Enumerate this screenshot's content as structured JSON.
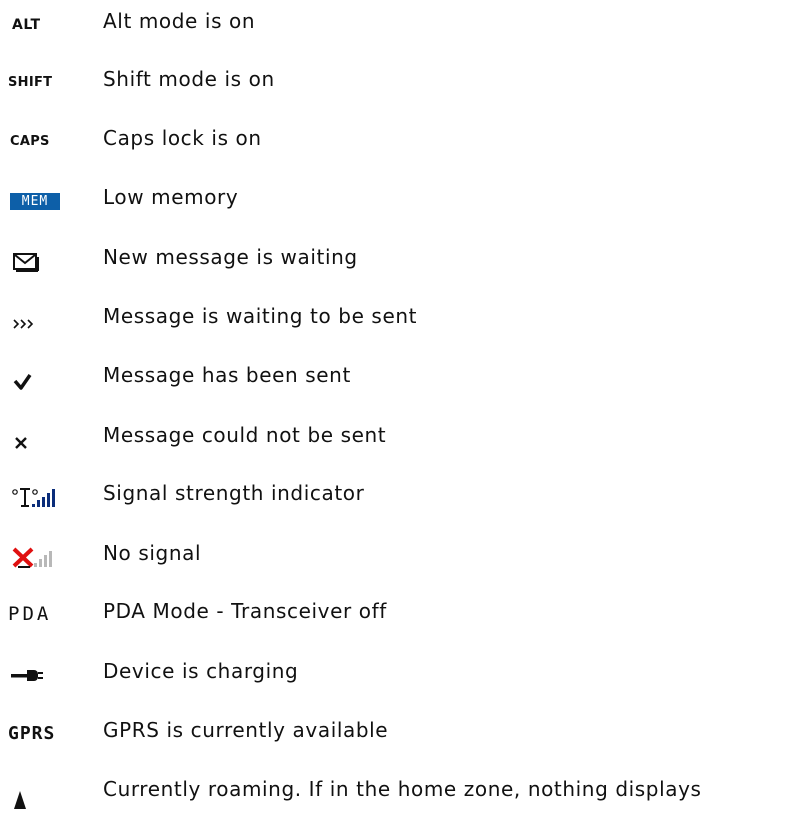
{
  "legend": {
    "items": [
      {
        "icon_name": "alt-icon",
        "icon_text": "ALT",
        "label": "Alt mode is on"
      },
      {
        "icon_name": "shift-icon",
        "icon_text": "SHIFT",
        "label": "Shift mode is on"
      },
      {
        "icon_name": "caps-icon",
        "icon_text": "CAPS",
        "label": "Caps lock is on"
      },
      {
        "icon_name": "mem-icon",
        "icon_text": "MEM",
        "label": "Low memory"
      },
      {
        "icon_name": "envelope-icon",
        "label": "New message is waiting"
      },
      {
        "icon_name": "sending-arrows-icon",
        "label": "Message is waiting to be sent"
      },
      {
        "icon_name": "checkmark-icon",
        "label": "Message has been sent"
      },
      {
        "icon_name": "x-mark-icon",
        "label": "Message could not be sent"
      },
      {
        "icon_name": "signal-strength-icon",
        "label": "Signal strength indicator"
      },
      {
        "icon_name": "no-signal-icon",
        "label": "No signal"
      },
      {
        "icon_name": "pda-icon",
        "icon_text": "PDA",
        "label": "PDA Mode - Transceiver off"
      },
      {
        "icon_name": "charging-plug-icon",
        "label": "Device is charging"
      },
      {
        "icon_name": "gprs-icon",
        "icon_text": "GPRS",
        "label": "GPRS is currently available"
      },
      {
        "icon_name": "roaming-triangle-icon",
        "label": "Currently roaming.  If in the home zone, nothing displays"
      }
    ]
  },
  "colors": {
    "mem_badge_bg": "#0d5fa8",
    "signal_bars": "#0a2d7a",
    "no_signal_x": "#e01010",
    "no_signal_bars": "#b8b8b8"
  }
}
